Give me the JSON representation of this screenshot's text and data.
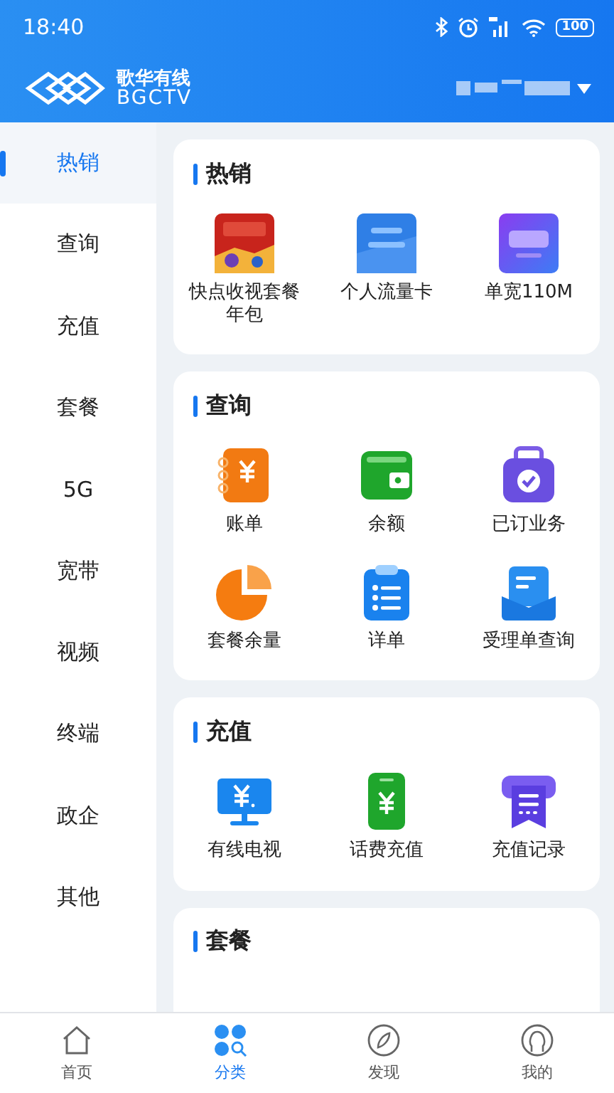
{
  "status_bar": {
    "time": "18:40",
    "battery": "100"
  },
  "header": {
    "brand_name": "歌华有线",
    "brand_sub": "BGCTV"
  },
  "sidebar": {
    "items": [
      {
        "label": "热销",
        "selected": true
      },
      {
        "label": "查询",
        "selected": false
      },
      {
        "label": "充值",
        "selected": false
      },
      {
        "label": "套餐",
        "selected": false
      },
      {
        "label": "5G",
        "selected": false
      },
      {
        "label": "宽带",
        "selected": false
      },
      {
        "label": "视频",
        "selected": false
      },
      {
        "label": "终端",
        "selected": false
      },
      {
        "label": "政企",
        "selected": false
      },
      {
        "label": "其他",
        "selected": false
      }
    ]
  },
  "sections": [
    {
      "title": "热销",
      "items": [
        {
          "label": "快点收视套餐年包",
          "kind": "picture"
        },
        {
          "label": "个人流量卡",
          "kind": "picture"
        },
        {
          "label": "单宽110M",
          "kind": "picture"
        }
      ]
    },
    {
      "title": "查询",
      "items": [
        {
          "label": "账单",
          "kind": "icon"
        },
        {
          "label": "余额",
          "kind": "icon"
        },
        {
          "label": "已订业务",
          "kind": "icon"
        },
        {
          "label": "套餐余量",
          "kind": "icon"
        },
        {
          "label": "详单",
          "kind": "icon"
        },
        {
          "label": "受理单查询",
          "kind": "icon"
        }
      ]
    },
    {
      "title": "充值",
      "items": [
        {
          "label": "有线电视",
          "kind": "icon"
        },
        {
          "label": "话费充值",
          "kind": "icon"
        },
        {
          "label": "充值记录",
          "kind": "icon"
        }
      ]
    },
    {
      "title": "套餐"
    }
  ],
  "bottom_nav": [
    {
      "label": "首页",
      "selected": false
    },
    {
      "label": "分类",
      "selected": true
    },
    {
      "label": "发现",
      "selected": false
    },
    {
      "label": "我的",
      "selected": false
    }
  ]
}
